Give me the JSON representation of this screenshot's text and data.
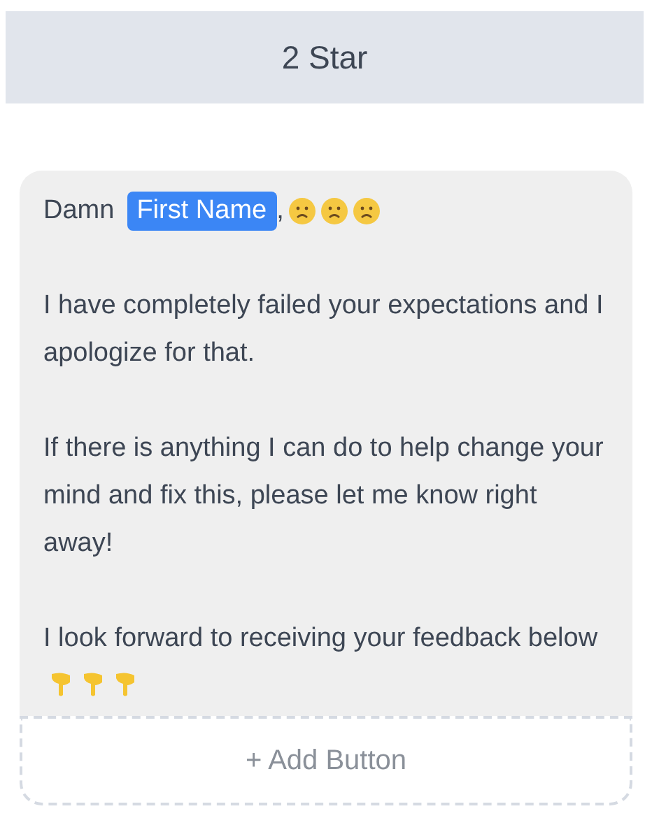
{
  "header": {
    "title": "2 Star"
  },
  "message": {
    "greeting": "Damn",
    "name_tag": "First Name",
    "after_tag": ",",
    "paragraphs": [
      "I have completely failed your expectations and I apologize for that.",
      "If there is anything I can do to help change your mind and fix this, please let me know right away!",
      "I look forward to receiving your feedback below"
    ]
  },
  "add_button": {
    "label": "+ Add Button"
  }
}
